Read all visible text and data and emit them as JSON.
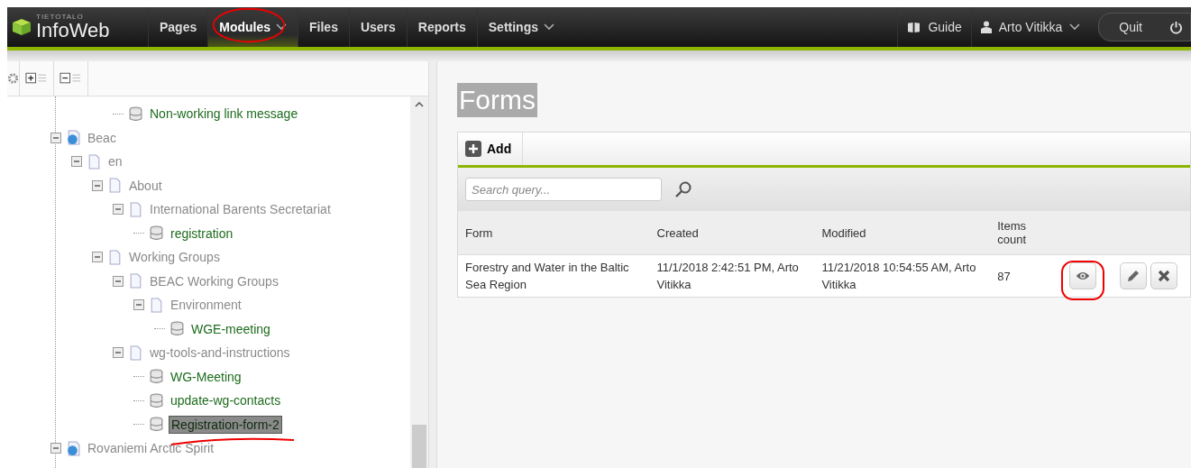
{
  "brand": {
    "small": "TIETOTALO",
    "name": "InfoWeb"
  },
  "nav": [
    {
      "label": "Pages",
      "selected": false,
      "has_menu": false
    },
    {
      "label": "Modules",
      "selected": true,
      "has_menu": true
    },
    {
      "label": "Files",
      "selected": false,
      "has_menu": false
    },
    {
      "label": "Users",
      "selected": false,
      "has_menu": false
    },
    {
      "label": "Reports",
      "selected": false,
      "has_menu": false
    },
    {
      "label": "Settings",
      "selected": false,
      "has_menu": true
    }
  ],
  "guide": "Guide",
  "user": "Arto Vitikka",
  "quit": "Quit",
  "tree": {
    "clipped_items": [
      {
        "label": "Non-working link message",
        "kind": "form",
        "selected": false
      }
    ],
    "items": [
      {
        "label": "Beac",
        "kind": "site",
        "expanded": true,
        "selected": false,
        "children": [
          {
            "label": "en",
            "kind": "page",
            "expanded": true,
            "selected": false,
            "children": [
              {
                "label": "About",
                "kind": "page",
                "expanded": true,
                "selected": false,
                "children": [
                  {
                    "label": "International Barents Secretariat",
                    "kind": "page",
                    "expanded": true,
                    "selected": false,
                    "children": [
                      {
                        "label": "registration",
                        "kind": "form",
                        "selected": false
                      }
                    ]
                  }
                ]
              },
              {
                "label": "Working Groups",
                "kind": "page",
                "expanded": true,
                "selected": false,
                "children": [
                  {
                    "label": "BEAC Working Groups",
                    "kind": "page",
                    "expanded": true,
                    "selected": false,
                    "children": [
                      {
                        "label": "Environment",
                        "kind": "page",
                        "expanded": true,
                        "selected": false,
                        "children": [
                          {
                            "label": "WGE-meeting",
                            "kind": "form",
                            "selected": false
                          }
                        ]
                      }
                    ]
                  },
                  {
                    "label": "wg-tools-and-instructions",
                    "kind": "page",
                    "expanded": true,
                    "selected": false,
                    "children": [
                      {
                        "label": "WG-Meeting",
                        "kind": "form",
                        "selected": false
                      },
                      {
                        "label": "update-wg-contacts",
                        "kind": "form",
                        "selected": false
                      },
                      {
                        "label": "Registration-form-2",
                        "kind": "form",
                        "selected": true
                      }
                    ]
                  }
                ]
              }
            ]
          }
        ]
      },
      {
        "label": "Rovaniemi Arctic Spirit",
        "kind": "site",
        "expanded": true,
        "selected": false
      }
    ]
  },
  "heading": "Forms",
  "add": "Add",
  "search": {
    "placeholder": "Search query..."
  },
  "table": {
    "columns": [
      "Form",
      "Created",
      "Modified",
      "Items count"
    ],
    "rows": [
      {
        "cells": [
          "Forestry and Water in the Baltic Sea Region",
          "11/1/2018 2:42:51 PM, Arto Vitikka",
          "11/21/2018 10:54:55 AM, Arto Vitikka",
          "87"
        ]
      }
    ]
  }
}
